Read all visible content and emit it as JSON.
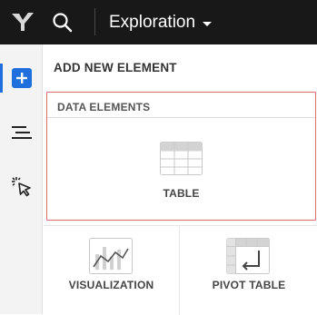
{
  "topbar": {
    "workspace_label": "Exploration"
  },
  "rail": {
    "items": [
      "add-element",
      "outline",
      "select"
    ]
  },
  "panel": {
    "title": "ADD NEW ELEMENT",
    "data_elements": {
      "label": "DATA ELEMENTS",
      "table_label": "TABLE"
    },
    "tiles": [
      {
        "label": "VISUALIZATION"
      },
      {
        "label": "PIVOT TABLE"
      }
    ]
  },
  "colors": {
    "topbar": "#181818",
    "accent": "#1f6fdc",
    "highlight_border": "#e26b6b"
  }
}
